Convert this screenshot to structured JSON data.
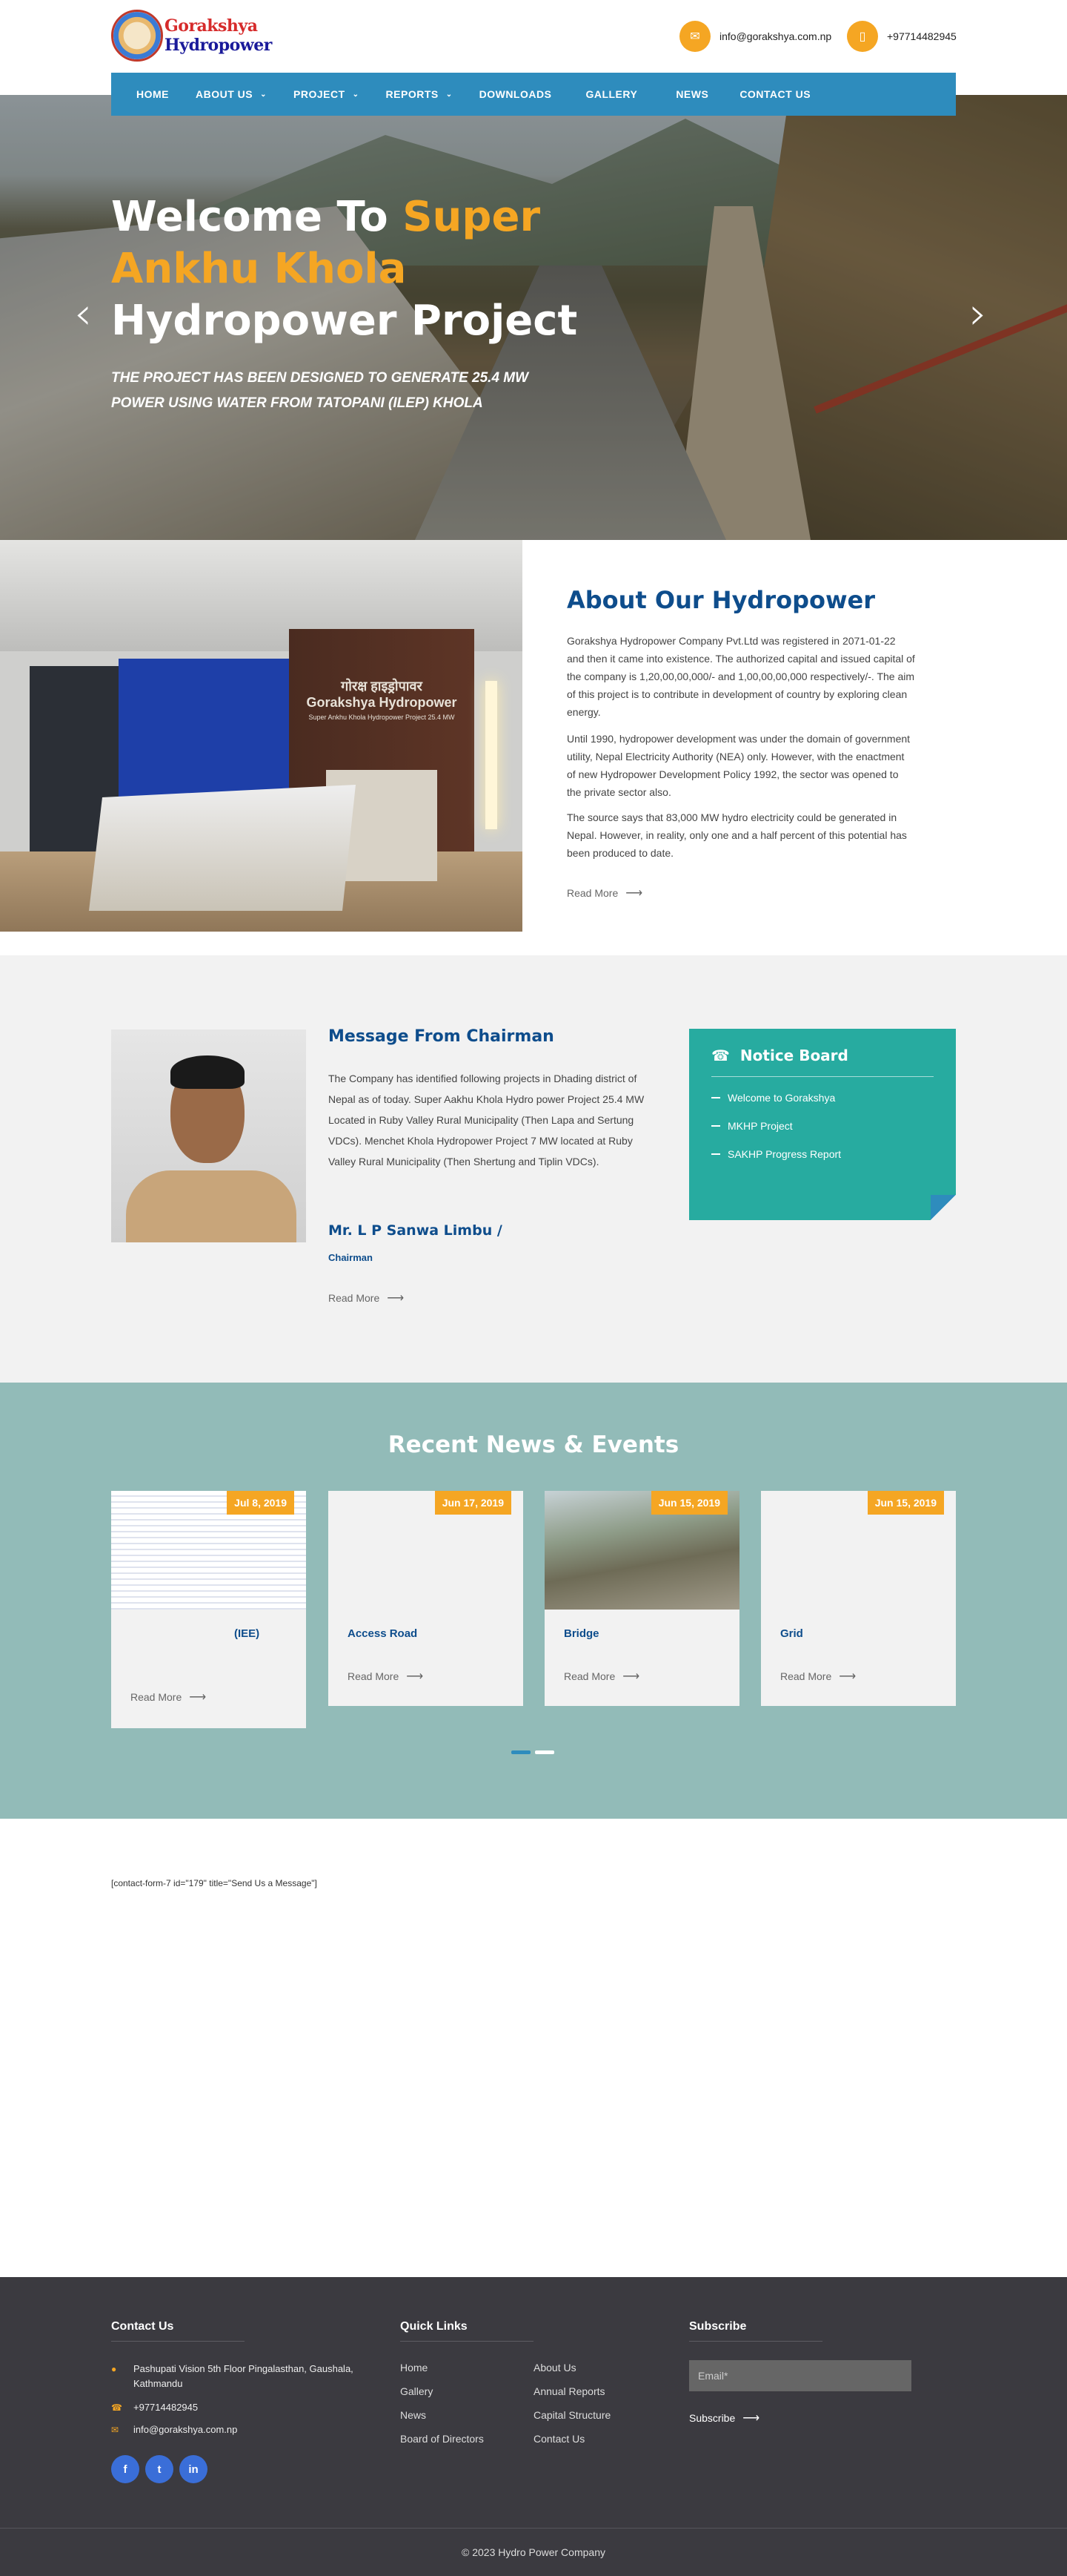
{
  "brand": {
    "name_part1": "Gorakshya",
    "name_part2": "Hydropower"
  },
  "header": {
    "email_icon": "envelope-icon",
    "email": "info@gorakshya.com.np",
    "phone_icon": "mobile-icon",
    "phone": "+97714482945"
  },
  "nav": {
    "items": [
      {
        "label": "HOME",
        "dropdown": false
      },
      {
        "label": "ABOUT US",
        "dropdown": true
      },
      {
        "label": "PROJECT",
        "dropdown": true
      },
      {
        "label": "REPORTS",
        "dropdown": true
      },
      {
        "label": "DOWNLOADS",
        "dropdown": false
      },
      {
        "label": "GALLERY",
        "dropdown": false
      },
      {
        "label": "NEWS",
        "dropdown": false
      },
      {
        "label": "CONTACT US",
        "dropdown": false
      }
    ]
  },
  "hero": {
    "title_part1": "Welcome To",
    "title_highlight": "Super Ankhu Khola",
    "title_part2": "Hydropower Project",
    "subtitle": "The project has been designed to generate 25.4 MW power using water from Tatopani (Ilep) khola",
    "prev_icon": "chevron-left-icon",
    "next_icon": "chevron-right-icon"
  },
  "about": {
    "title": "About Our Hydropower",
    "paragraphs": [
      "Gorakshya Hydropower Company Pvt.Ltd was registered in 2071-01-22 and then it came into existence. The authorized capital and issued capital of the company is 1,20,00,00,000/- and 1,00,00,00,000 respectively/-. The aim of this project is to contribute in development of country by exploring clean energy.",
      "Until 1990, hydropower development was under the domain of government utility, Nepal Electricity Authority (NEA) only. However, with the enactment of new Hydropower Development Policy 1992, the sector was opened to the private sector also.",
      "The source says that 83,000 MW hydro electricity could be generated in Nepal. However, in reality, only one and a half percent of this potential has been produced to date."
    ],
    "image_sign_np": "गोरक्ष हाइड्रोपावर",
    "image_sign_en": "Gorakshya Hydropower",
    "image_sign_small": "Super Ankhu Khola Hydropower Project 25.4 MW",
    "read_more": "Read More"
  },
  "chairman": {
    "title": "Message From Chairman",
    "message": "The Company has identified following projects in Dhading district of Nepal as of today. Super Aakhu Khola Hydro power Project 25.4 MW Located in Ruby Valley Rural Municipality (Then Lapa and Sertung VDCs). Menchet Khola Hydropower Project 7 MW located at Ruby Valley Rural Municipality (Then Shertung and Tiplin VDCs).",
    "name": "Mr. L P Sanwa Limbu /",
    "role": "Chairman",
    "read_more": "Read More"
  },
  "notice_board": {
    "title": "Notice Board",
    "icon": "bell-icon",
    "items": [
      "Welcome to Gorakshya",
      "MKHP Project",
      "SAKHP Progress Report"
    ]
  },
  "news": {
    "title": "Recent News & Events",
    "cards": [
      {
        "date": "Jul 8, 2019",
        "title": "(IEE)",
        "read_more": "Read More"
      },
      {
        "date": "Jun 17, 2019",
        "title": "Access Road",
        "read_more": "Read More"
      },
      {
        "date": "Jun 15, 2019",
        "title": "Bridge",
        "read_more": "Read More"
      },
      {
        "date": "Jun 15, 2019",
        "title": "Grid",
        "read_more": "Read More"
      }
    ],
    "carousel_active_page": 1,
    "carousel_pages": 2
  },
  "contact_form_shortcode": "[contact-form-7 id=\"179\" title=\"Send Us a Message\"]",
  "footer": {
    "contact": {
      "title": "Contact Us",
      "address": "Pashupati Vision 5th Floor Pingalasthan, Gaushala, Kathmandu",
      "phone": "+97714482945",
      "email": "info@gorakshya.com.np",
      "social": [
        "facebook-icon",
        "twitter-icon",
        "linkedin-icon"
      ]
    },
    "quick_links": {
      "title": "Quick Links",
      "col1": [
        "Home",
        "Gallery",
        "News",
        "Board of Directors"
      ],
      "col2": [
        "About Us",
        "Annual Reports",
        "Capital Structure",
        "Contact Us"
      ]
    },
    "subscribe": {
      "title": "Subscribe",
      "placeholder": "Email*",
      "button": "Subscribe"
    },
    "copyright": "© 2023 Hydro Power Company"
  },
  "colors": {
    "accent": "#f5a623",
    "nav": "#2e8cbd",
    "title": "#0e4d8c",
    "notice": "#27aba0",
    "news_bg": "#92bbb8",
    "footer": "#3b3a40"
  }
}
